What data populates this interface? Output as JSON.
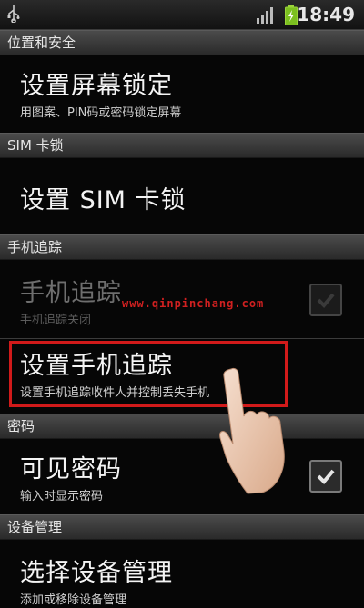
{
  "status_bar": {
    "time": "18:49",
    "icons": [
      "usb-icon",
      "signal-icon",
      "battery-charging-icon"
    ]
  },
  "sections": {
    "location_security": {
      "header": "位置和安全",
      "screen_lock": {
        "title": "设置屏幕锁定",
        "summary": "用图案、PIN码或密码锁定屏幕"
      }
    },
    "sim_lock": {
      "header": "SIM 卡锁",
      "sim_lock_item": {
        "title": "设置 SIM 卡锁"
      }
    },
    "phone_tracking": {
      "header": "手机追踪",
      "tracking_toggle": {
        "title": "手机追踪",
        "summary": "手机追踪关闭",
        "checked": false,
        "enabled": false
      },
      "tracking_setup": {
        "title": "设置手机追踪",
        "summary": "设置手机追踪收件人并控制丢失手机"
      }
    },
    "passwords": {
      "header": "密码",
      "visible_password": {
        "title": "可见密码",
        "summary": "输入时显示密码",
        "checked": true
      }
    },
    "device_admin": {
      "header": "设备管理",
      "select_admin": {
        "title": "选择设备管理",
        "summary": "添加或移除设备管理"
      }
    }
  },
  "overlay": {
    "watermark": "www.qinpinchang.com",
    "highlight_color": "#d11a1a"
  }
}
